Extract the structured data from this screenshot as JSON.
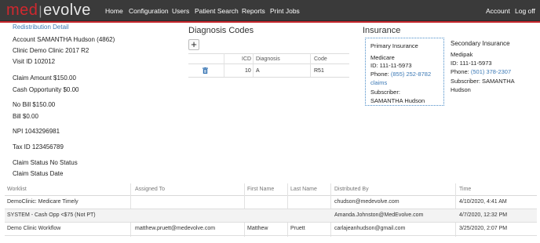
{
  "brand": {
    "part1": "med",
    "separator": "|",
    "part2": "evolve"
  },
  "nav": {
    "home": "Home",
    "configuration": "Configuration",
    "users": "Users",
    "patient_search": "Patient Search",
    "reports": "Reports",
    "print_jobs": "Print Jobs",
    "account": "Account",
    "logoff": "Log off"
  },
  "detail": {
    "title": "Redistribution Detail",
    "account": "Account SAMANTHA Hudson (4862)",
    "clinic": "Clinic Demo Clinic 2017 R2",
    "visit": "Visit ID 102012",
    "claim_amount": "Claim Amount $150.00",
    "cash_opportunity": "Cash Opportunity $0.00",
    "no_bill": "No Bill $150.00",
    "bill": "Bill $0.00",
    "npi": "NPI 1043296981",
    "tax": "Tax ID 123456789",
    "claim_status": "Claim Status No Status",
    "claim_status_date": "Claim Status Date"
  },
  "diagnosis": {
    "title": "Diagnosis Codes",
    "add_label": "+",
    "headers": {
      "icd": "ICD",
      "diagnosis": "Diagnosis",
      "code": "Code"
    },
    "rows": [
      {
        "icd": "10",
        "diagnosis": "A",
        "code": "R51"
      }
    ]
  },
  "insurance": {
    "title": "Insurance",
    "primary": {
      "heading": "Primary Insurance",
      "name": "Medicare",
      "id": "ID: 111-11-5973",
      "phone_label": "Phone: ",
      "phone": "(855) 252-8782",
      "phone_suffix": "claims",
      "subscriber_label": "Subscriber:",
      "subscriber": "SAMANTHA Hudson"
    },
    "secondary": {
      "heading": "Secondary Insurance",
      "name": "Medipak",
      "id": "ID: 111-11-5973",
      "phone_label": "Phone: ",
      "phone": "(501) 378-2307",
      "subscriber_label": "Subscriber: SAMANTHA",
      "subscriber": "Hudson"
    }
  },
  "worklist": {
    "headers": {
      "worklist": "Worklist",
      "assigned_to": "Assigned To",
      "first_name": "First Name",
      "last_name": "Last Name",
      "distributed_by": "Distributed By",
      "time": "Time"
    },
    "rows": [
      {
        "worklist": "DemoClinic: Medicare Timely",
        "assigned_to": "",
        "first_name": "",
        "last_name": "",
        "distributed_by": "chudson@medevolve.com",
        "time": "4/10/2020, 4:41 AM"
      },
      {
        "worklist": "SYSTEM - Cash Opp <$75 (Not PT)",
        "assigned_to": "",
        "first_name": "",
        "last_name": "",
        "distributed_by": "Amanda.Johnston@MedEvolve.com",
        "time": "4/7/2020, 12:32 PM"
      },
      {
        "worklist": "Demo Clinic Workflow",
        "assigned_to": "matthew.pruett@medevolve.com",
        "first_name": "Matthew",
        "last_name": "Pruett",
        "distributed_by": "carlajeanhudson@gmail.com",
        "time": "3/25/2020, 2:07 PM"
      }
    ]
  },
  "colors": {
    "navbar": "#3a3a3a",
    "brand_red": "#d0282e",
    "accent_blue": "#3a78b5",
    "border_dotted": "#4a8cc8"
  }
}
